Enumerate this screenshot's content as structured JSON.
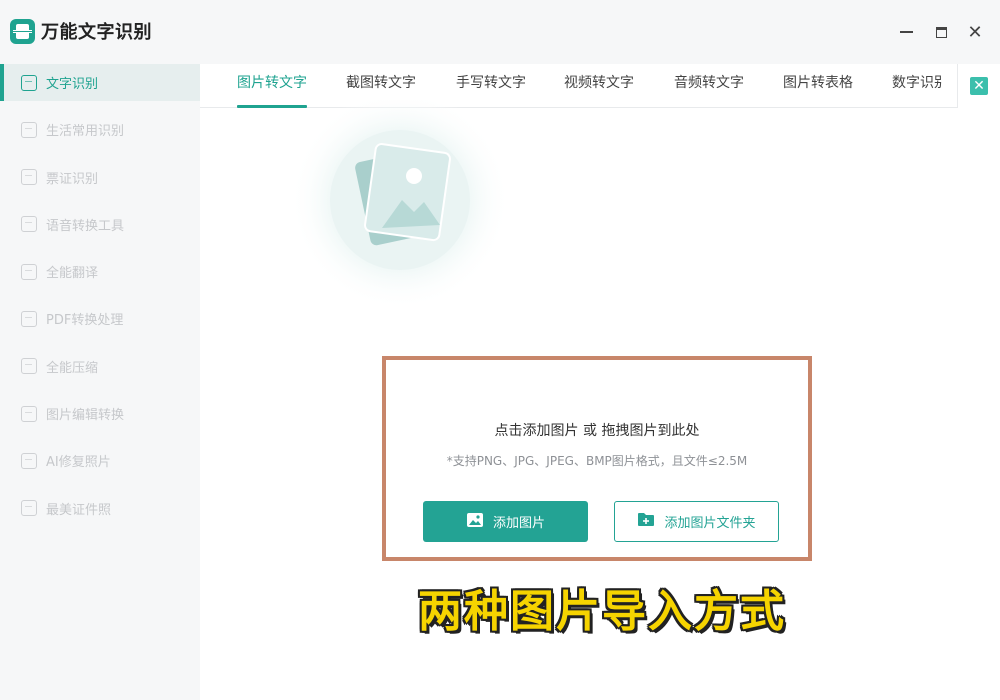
{
  "app": {
    "name": "万能文字识别"
  },
  "window_controls": {
    "minimize_icon": "minimize-icon",
    "maximize_icon": "maximize-icon",
    "close_icon": "close-icon",
    "close_glyph": "✕"
  },
  "sidebar": {
    "items": [
      {
        "label": "文字识别",
        "icon": "text-scan-icon",
        "active": true
      },
      {
        "label": "生活常用识别",
        "icon": "scan-icon",
        "active": false
      },
      {
        "label": "票证识别",
        "icon": "ticket-scan-icon",
        "active": false
      },
      {
        "label": "语音转换工具",
        "icon": "voice-icon",
        "active": false
      },
      {
        "label": "全能翻译",
        "icon": "translate-icon",
        "active": false
      },
      {
        "label": "PDF转换处理",
        "icon": "pdf-icon",
        "active": false
      },
      {
        "label": "全能压缩",
        "icon": "compress-icon",
        "active": false
      },
      {
        "label": "图片编辑转换",
        "icon": "image-edit-icon",
        "active": false
      },
      {
        "label": "AI修复照片",
        "icon": "ai-repair-icon",
        "active": false
      },
      {
        "label": "最美证件照",
        "icon": "id-photo-icon",
        "active": false
      }
    ]
  },
  "tabs": {
    "items": [
      {
        "label": "图片转文字",
        "active": true
      },
      {
        "label": "截图转文字",
        "active": false
      },
      {
        "label": "手写转文字",
        "active": false
      },
      {
        "label": "视频转文字",
        "active": false
      },
      {
        "label": "音频转文字",
        "active": false
      },
      {
        "label": "图片转表格",
        "active": false
      },
      {
        "label": "数字识别",
        "active": false
      }
    ],
    "more_glyph": "✕"
  },
  "upload": {
    "title": "点击添加图片 或 拖拽图片到此处",
    "hint": "*支持PNG、JPG、JPEG、BMP图片格式，且文件≤2.5M",
    "add_image_label": "添加图片",
    "add_folder_label": "添加图片文件夹"
  },
  "caption": {
    "text": "两种图片导入方式"
  },
  "colors": {
    "accent": "#1fa390",
    "highlight_border": "#c8866a",
    "caption_fill": "#f6d400"
  }
}
